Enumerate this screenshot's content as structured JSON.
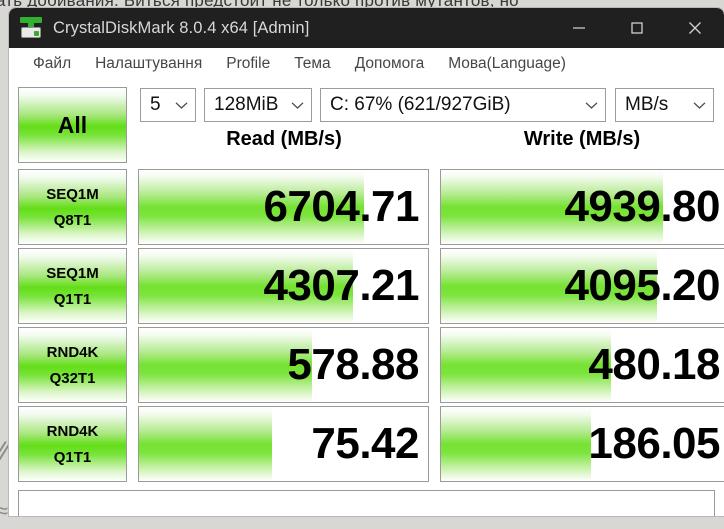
{
  "desktop": {
    "background_text": "ать добивания. Биться предстоит не только против мутантов, но"
  },
  "window": {
    "title": "CrystalDiskMark 8.0.4 x64 [Admin]",
    "icon": "disk-drive-icon",
    "controls": {
      "minimize": "minimize-icon",
      "maximize": "maximize-icon",
      "close": "close-icon"
    }
  },
  "menubar": {
    "items": [
      {
        "label": "Файл"
      },
      {
        "label": "Налаштування"
      },
      {
        "label": "Profile"
      },
      {
        "label": "Тема"
      },
      {
        "label": "Допомога"
      },
      {
        "label": "Мова(Language)"
      }
    ]
  },
  "toolbar": {
    "all_button": "All",
    "runs": "5",
    "size": "128MiB",
    "drive": "C: 67% (621/927GiB)",
    "unit": "MB/s"
  },
  "headers": {
    "read": "Read (MB/s)",
    "write": "Write (MB/s)"
  },
  "chart_data": {
    "type": "bar",
    "title": "CrystalDiskMark 8.0.4 x64 results",
    "categories": [
      "SEQ1M Q8T1",
      "SEQ1M Q1T1",
      "RND4K Q32T1",
      "RND4K Q1T1"
    ],
    "series": [
      {
        "name": "Read (MB/s)",
        "values": [
          6704.71,
          4307.21,
          578.88,
          75.42
        ]
      },
      {
        "name": "Write (MB/s)",
        "values": [
          4939.8,
          4095.2,
          480.18,
          186.05
        ]
      }
    ],
    "unit": "MB/s",
    "legend": "top",
    "grid": false
  },
  "rows": [
    {
      "name_line1": "SEQ1M",
      "name_line2": "Q8T1",
      "read": {
        "value": "6704.71",
        "fill_pct": 78
      },
      "write": {
        "value": "4939.80",
        "fill_pct": 77
      }
    },
    {
      "name_line1": "SEQ1M",
      "name_line2": "Q1T1",
      "read": {
        "value": "4307.21",
        "fill_pct": 74
      },
      "write": {
        "value": "4095.20",
        "fill_pct": 75
      }
    },
    {
      "name_line1": "RND4K",
      "name_line2": "Q32T1",
      "read": {
        "value": "578.88",
        "fill_pct": 60
      },
      "write": {
        "value": "480.18",
        "fill_pct": 59
      }
    },
    {
      "name_line1": "RND4K",
      "name_line2": "Q1T1",
      "read": {
        "value": "75.42",
        "fill_pct": 46
      },
      "write": {
        "value": "186.05",
        "fill_pct": 52
      }
    }
  ],
  "comment_box": {
    "value": ""
  },
  "colors": {
    "accent_green": "#63de17",
    "titlebar": "#202020",
    "border": "#9a9a9a"
  }
}
